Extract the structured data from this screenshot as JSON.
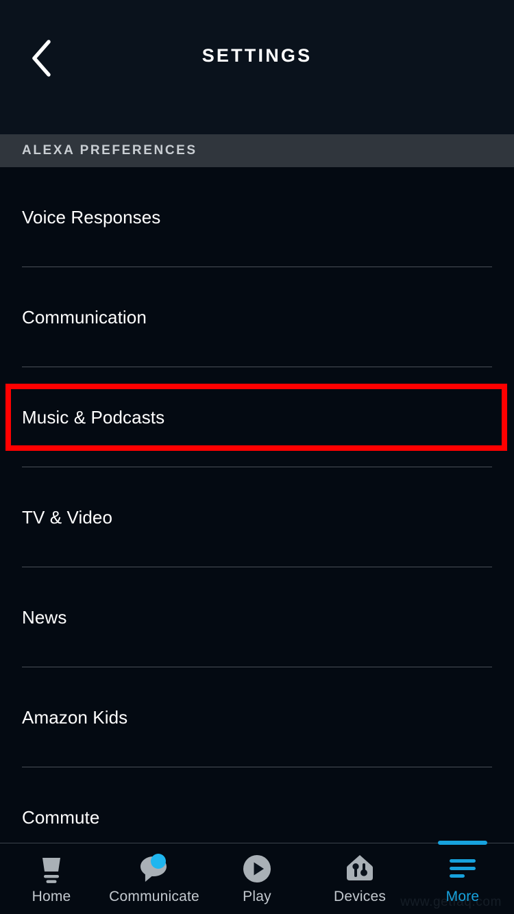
{
  "header": {
    "title": "SETTINGS",
    "back_icon": "chevron-left-icon",
    "background_color": "#0a121c"
  },
  "section": {
    "label": "ALEXA PREFERENCES",
    "background_color": "#30363d",
    "text_color": "#c9ced3"
  },
  "list": {
    "items": [
      {
        "label": "Voice Responses"
      },
      {
        "label": "Communication"
      },
      {
        "label": "Music & Podcasts",
        "highlighted": true
      },
      {
        "label": "TV & Video"
      },
      {
        "label": "News"
      },
      {
        "label": "Amazon Kids"
      },
      {
        "label": "Commute"
      }
    ]
  },
  "annotation": {
    "target_label": "Music & Podcasts",
    "color": "#ff0000",
    "border_width_px": 8
  },
  "bottom_nav": {
    "active_tab": "More",
    "active_color": "#17a2dd",
    "inactive_color": "#c3c9cf",
    "items": [
      {
        "label": "Home",
        "icon": "echo-device-icon",
        "active": false,
        "badge": false
      },
      {
        "label": "Communicate",
        "icon": "speech-bubble-icon",
        "active": false,
        "badge": true
      },
      {
        "label": "Play",
        "icon": "play-circle-icon",
        "active": false,
        "badge": false
      },
      {
        "label": "Devices",
        "icon": "smart-home-icon",
        "active": false,
        "badge": false
      },
      {
        "label": "More",
        "icon": "hamburger-menu-icon",
        "active": true,
        "badge": false
      }
    ]
  },
  "watermark": {
    "text": "www.getfaq.com"
  }
}
